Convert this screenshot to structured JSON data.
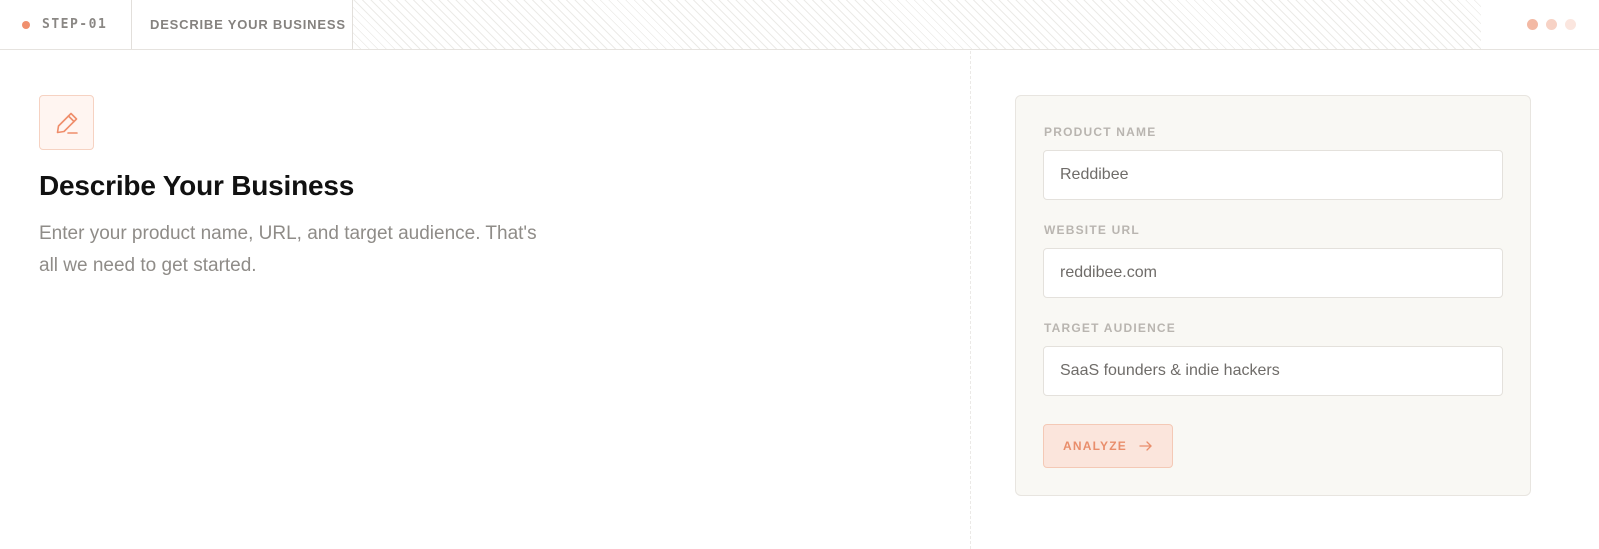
{
  "header": {
    "step_label": "STEP-01",
    "section_title": "DESCRIBE YOUR BUSINESS",
    "step_dot_color": "#f0906e",
    "window_dot_colors": [
      "#f3b9a4",
      "#f7d2c5",
      "#fbe6df"
    ]
  },
  "hero": {
    "icon": "pencil-icon",
    "title": "Describe Your Business",
    "description": "Enter your product name, URL, and target audience. That's all we need to get started."
  },
  "form": {
    "product_name": {
      "label": "PRODUCT NAME",
      "value": "Reddibee"
    },
    "website_url": {
      "label": "WEBSITE URL",
      "value": "reddibee.com"
    },
    "target_audience": {
      "label": "TARGET AUDIENCE",
      "value": "SaaS founders & indie hackers"
    },
    "submit": {
      "label": "ANALYZE",
      "icon": "arrow-right-icon"
    }
  },
  "colors": {
    "accent": "#f0906e",
    "card_background": "#f9f8f4"
  }
}
